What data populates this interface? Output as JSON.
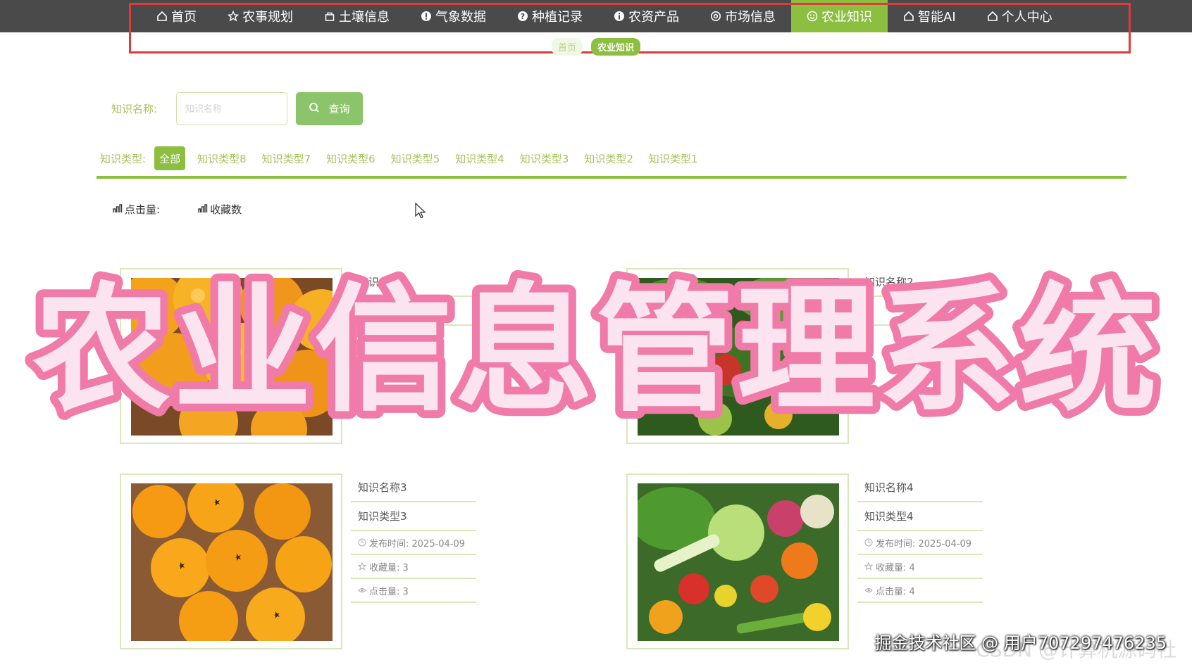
{
  "nav": {
    "items": [
      {
        "label": "首页",
        "icon": "home-icon"
      },
      {
        "label": "农事规划",
        "icon": "star-icon"
      },
      {
        "label": "土壤信息",
        "icon": "bag-icon"
      },
      {
        "label": "气象数据",
        "icon": "info-icon"
      },
      {
        "label": "种植记录",
        "icon": "question-icon"
      },
      {
        "label": "农资产品",
        "icon": "info-icon"
      },
      {
        "label": "市场信息",
        "icon": "gear-icon"
      },
      {
        "label": "农业知识",
        "icon": "smile-icon",
        "active": true
      },
      {
        "label": "智能AI",
        "icon": "home-icon"
      },
      {
        "label": "个人中心",
        "icon": "home-icon"
      }
    ]
  },
  "breadcrumb": [
    "首页",
    "农业知识"
  ],
  "search": {
    "label": "知识名称:",
    "placeholder": "知识名称",
    "button": "查询"
  },
  "filter": {
    "label": "知识类型:",
    "options": [
      "全部",
      "知识类型8",
      "知识类型7",
      "知识类型6",
      "知识类型5",
      "知识类型4",
      "知识类型3",
      "知识类型2",
      "知识类型1"
    ],
    "active_index": 0
  },
  "sort": {
    "clicks": "点击量:",
    "favorites": "收藏数"
  },
  "cards": [
    {
      "name": "知识名称1",
      "type": "",
      "image": "oranges-in-bowl"
    },
    {
      "name": "知识名称2",
      "type": "",
      "image": "vegetables-in-garden"
    },
    {
      "name": "知识名称3",
      "type": "知识类型3",
      "publish": "发布时间: 2025-04-09",
      "fav": "收藏量: 3",
      "views": "点击量: 3",
      "image": "loquats-in-bowl"
    },
    {
      "name": "知识名称4",
      "type": "知识类型4",
      "publish": "发布时间: 2025-04-09",
      "fav": "收藏量: 4",
      "views": "点击量: 4",
      "image": "vegetable-assortment"
    }
  ],
  "overlay_title": "农业信息管理系统",
  "watermark": "掘金技术社区 @ 用户707297476235",
  "watermark_ghost": "CSDN @计算机源码社",
  "colors": {
    "accent": "#8cbf3f",
    "nav_bg": "#4a4a4a",
    "highlight_box": "#e03a3a",
    "overlay_pink": "#f07aa8"
  }
}
